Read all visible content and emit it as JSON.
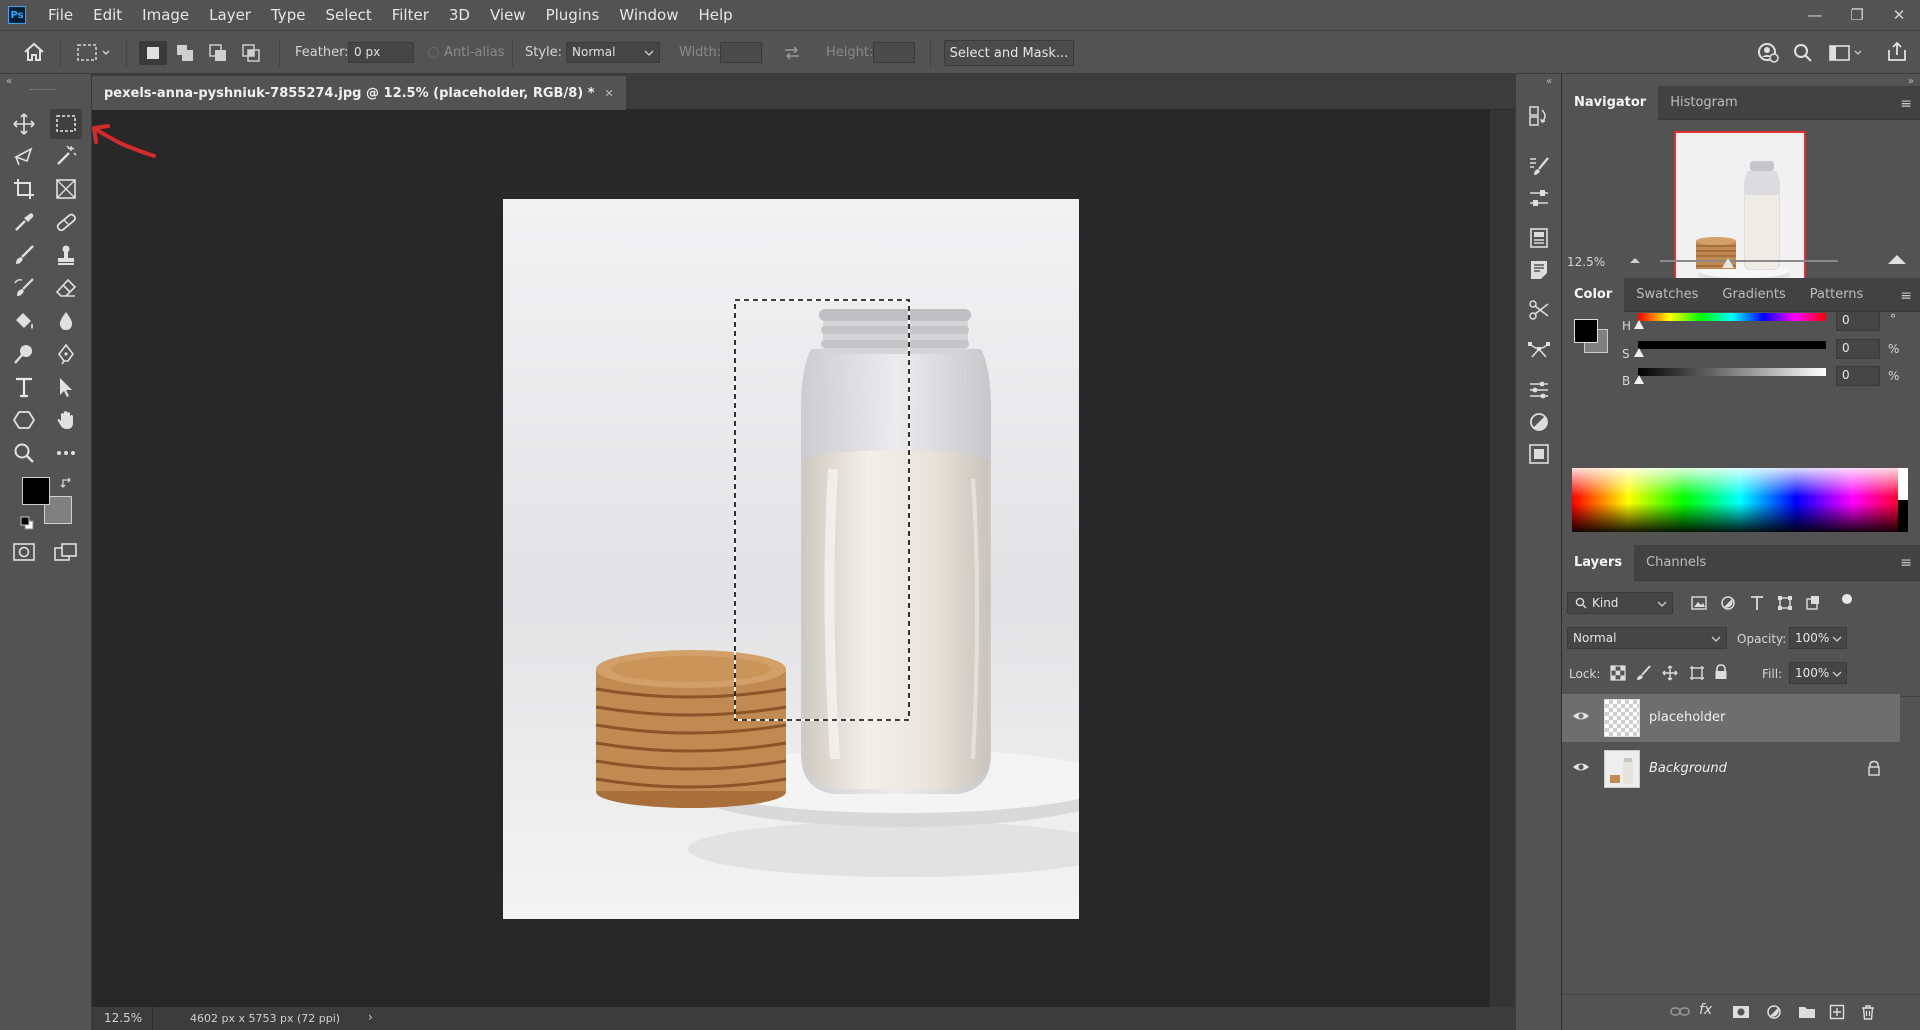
{
  "app": {
    "logo": "Ps"
  },
  "menu": [
    "File",
    "Edit",
    "Image",
    "Layer",
    "Type",
    "Select",
    "Filter",
    "3D",
    "View",
    "Plugins",
    "Window",
    "Help"
  ],
  "window_controls": {
    "minimize": "—",
    "restore": "❐",
    "close": "✕"
  },
  "options": {
    "feather_label": "Feather:",
    "feather_value": "0 px",
    "antialias_label": "Anti-alias",
    "style_label": "Style:",
    "style_value": "Normal",
    "width_label": "Width:",
    "height_label": "Height:",
    "select_mask_label": "Select and Mask..."
  },
  "document": {
    "tab_title": "pexels-anna-pyshniuk-7855274.jpg @ 12.5% (placeholder, RGB/8) *",
    "tab_close": "✕",
    "zoom": "12.5%",
    "dimensions": "4602 px x 5753 px (72 ppi)",
    "status_arrow": "›"
  },
  "navigator": {
    "tabs": [
      "Navigator",
      "Histogram"
    ],
    "zoom": "12.5%",
    "zoom_slider": 0.38
  },
  "color": {
    "tabs": [
      "Color",
      "Swatches",
      "Gradients",
      "Patterns"
    ],
    "channels": [
      {
        "label": "H",
        "value": "0",
        "unit": "°"
      },
      {
        "label": "S",
        "value": "0",
        "unit": "%"
      },
      {
        "label": "B",
        "value": "0",
        "unit": "%"
      }
    ],
    "foreground": "#000000",
    "background": "#808080"
  },
  "layers": {
    "tabs": [
      "Layers",
      "Channels"
    ],
    "kind_label": "Kind",
    "blend_mode": "Normal",
    "opacity_label": "Opacity:",
    "opacity_value": "100%",
    "lock_label": "Lock:",
    "fill_label": "Fill:",
    "fill_value": "100%",
    "items": [
      {
        "name": "placeholder",
        "selected": true,
        "italic": false,
        "locked": false
      },
      {
        "name": "Background",
        "selected": false,
        "italic": true,
        "locked": true
      }
    ]
  },
  "colors": {
    "accent": "#31a8ff",
    "annotation_arrow": "#d42a2a",
    "selection_ants": "#000000"
  }
}
